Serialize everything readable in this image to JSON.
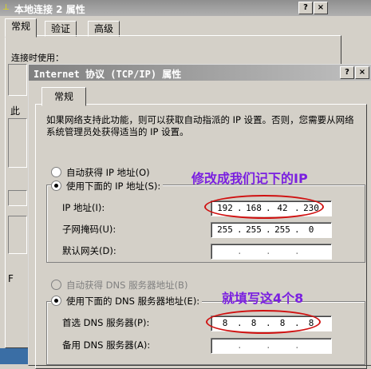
{
  "bg_window": {
    "title": "本地连接 2 属性",
    "title_buttons": [
      "?",
      "×"
    ],
    "tabs": [
      "常规",
      "验证",
      "高级"
    ],
    "fragment_text": "连接时使用：",
    "fragment_chars": [
      "此",
      "F"
    ]
  },
  "dialog": {
    "title": "Internet 协议 (TCP/IP) 属性",
    "title_buttons": [
      "?",
      "×"
    ],
    "tab": "常规",
    "description": "如果网络支持此功能，则可以获取自动指派的 IP 设置。否则，您需要从网络系统管理员处获得适当的 IP 设置。",
    "ip_mode": {
      "auto_label": "自动获得 IP 地址(O)",
      "manual_label": "使用下面的 IP 地址(S):",
      "selected": "manual"
    },
    "ip_fields": {
      "ip_label": "IP 地址(I):",
      "ip_value": [
        "192",
        "168",
        "42",
        "230"
      ],
      "mask_label": "子网掩码(U):",
      "mask_value": [
        "255",
        "255",
        "255",
        "0"
      ],
      "gateway_label": "默认网关(D):",
      "gateway_value": [
        "",
        "",
        "",
        ""
      ]
    },
    "dns_mode": {
      "auto_label": "自动获得 DNS 服务器地址(B)",
      "manual_label": "使用下面的 DNS 服务器地址(E):",
      "selected": "manual"
    },
    "dns_fields": {
      "preferred_label": "首选 DNS 服务器(P):",
      "preferred_value": [
        "8",
        "8",
        "8",
        "8"
      ],
      "alternate_label": "备用 DNS 服务器(A):",
      "alternate_value": [
        "",
        "",
        "",
        ""
      ]
    }
  },
  "annotations": {
    "ip_note": "修改成我们记下的IP",
    "dns_note": "就填写这4个8",
    "note_color": "#7a1fe0",
    "ellipse_color": "#d01010"
  }
}
